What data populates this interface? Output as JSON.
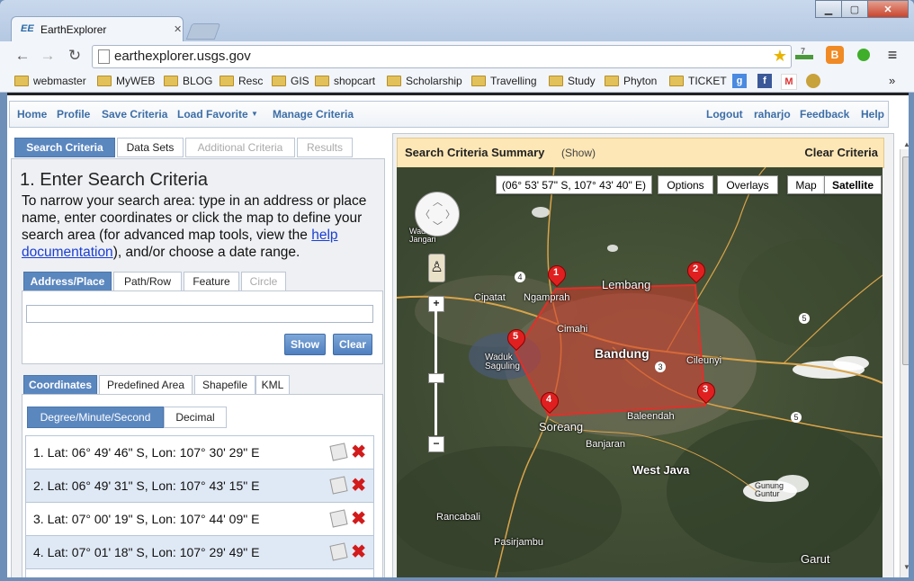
{
  "browser": {
    "tab_favicon": "EE",
    "tab_title": "EarthExplorer",
    "url": "earthexplorer.usgs.gov",
    "ext_badge": "7",
    "bookmarks": [
      "webmaster",
      "MyWEB",
      "BLOG",
      "Resc",
      "GIS",
      "shopcart",
      "Scholarship",
      "Travelling",
      "Study",
      "Phyton",
      "TICKET"
    ],
    "more": "»"
  },
  "appnav": {
    "left": [
      "Home",
      "Profile",
      "Save Criteria",
      "Load Favorite",
      "Manage Criteria"
    ],
    "load_favorite_caret": "▼",
    "right": [
      "Logout",
      "raharjo",
      "Feedback",
      "Help"
    ]
  },
  "main_tabs": [
    "Search Criteria",
    "Data Sets",
    "Additional Criteria",
    "Results"
  ],
  "search": {
    "title": "1. Enter Search Criteria",
    "instructions_pre": "To narrow your search area: type in an address or place name, enter coordinates or click the map to define your search area (for advanced map tools, view the ",
    "instructions_link": "help documentation",
    "instructions_post": "), and/or choose a date range."
  },
  "area_tabs": [
    "Address/Place",
    "Path/Row",
    "Feature",
    "Circle"
  ],
  "address": {
    "value": "",
    "show_label": "Show",
    "clear_label": "Clear"
  },
  "coord_tabs": [
    "Coordinates",
    "Predefined Area",
    "Shapefile",
    "KML"
  ],
  "format_tabs": [
    "Degree/Minute/Second",
    "Decimal"
  ],
  "coordinates": [
    "1.  Lat: 06° 49' 46\" S, Lon: 107° 30' 29\" E",
    "2.  Lat: 06° 49' 31\" S, Lon: 107° 43' 15\" E",
    "3.  Lat: 07° 00' 19\" S, Lon: 107° 44' 09\" E",
    "4.  Lat: 07° 01' 18\" S, Lon: 107° 29' 49\" E"
  ],
  "summary": {
    "title": "Search Criteria Summary",
    "show": "(Show)",
    "clear": "Clear Criteria"
  },
  "map": {
    "cursor_coords": "(06° 53' 57\" S, 107° 43' 40\" E)",
    "options": "Options",
    "overlays": "Overlays",
    "map_type": "Map",
    "satellite": "Satellite",
    "places": {
      "lembang": "Lembang",
      "cipatat": "Cipatat",
      "ngamprah": "Ngamprah",
      "cimahi": "Cimahi",
      "bandung": "Bandung",
      "cileunyi": "Cileunyi",
      "waduk_saguling": "Waduk Saguling",
      "waduk_jangari": "Waduk Jangari",
      "soreang": "Soreang",
      "baleendah": "Baleendah",
      "banjaran": "Banjaran",
      "west_java": "West Java",
      "gunung_guntur": "Gunung Guntur",
      "rancabali": "Rancabali",
      "pasirjambu": "Pasirjambu",
      "garut": "Garut"
    },
    "road_numbers": [
      "4",
      "5",
      "3",
      "5"
    ],
    "markers": [
      "1",
      "2",
      "3",
      "4",
      "5"
    ]
  }
}
